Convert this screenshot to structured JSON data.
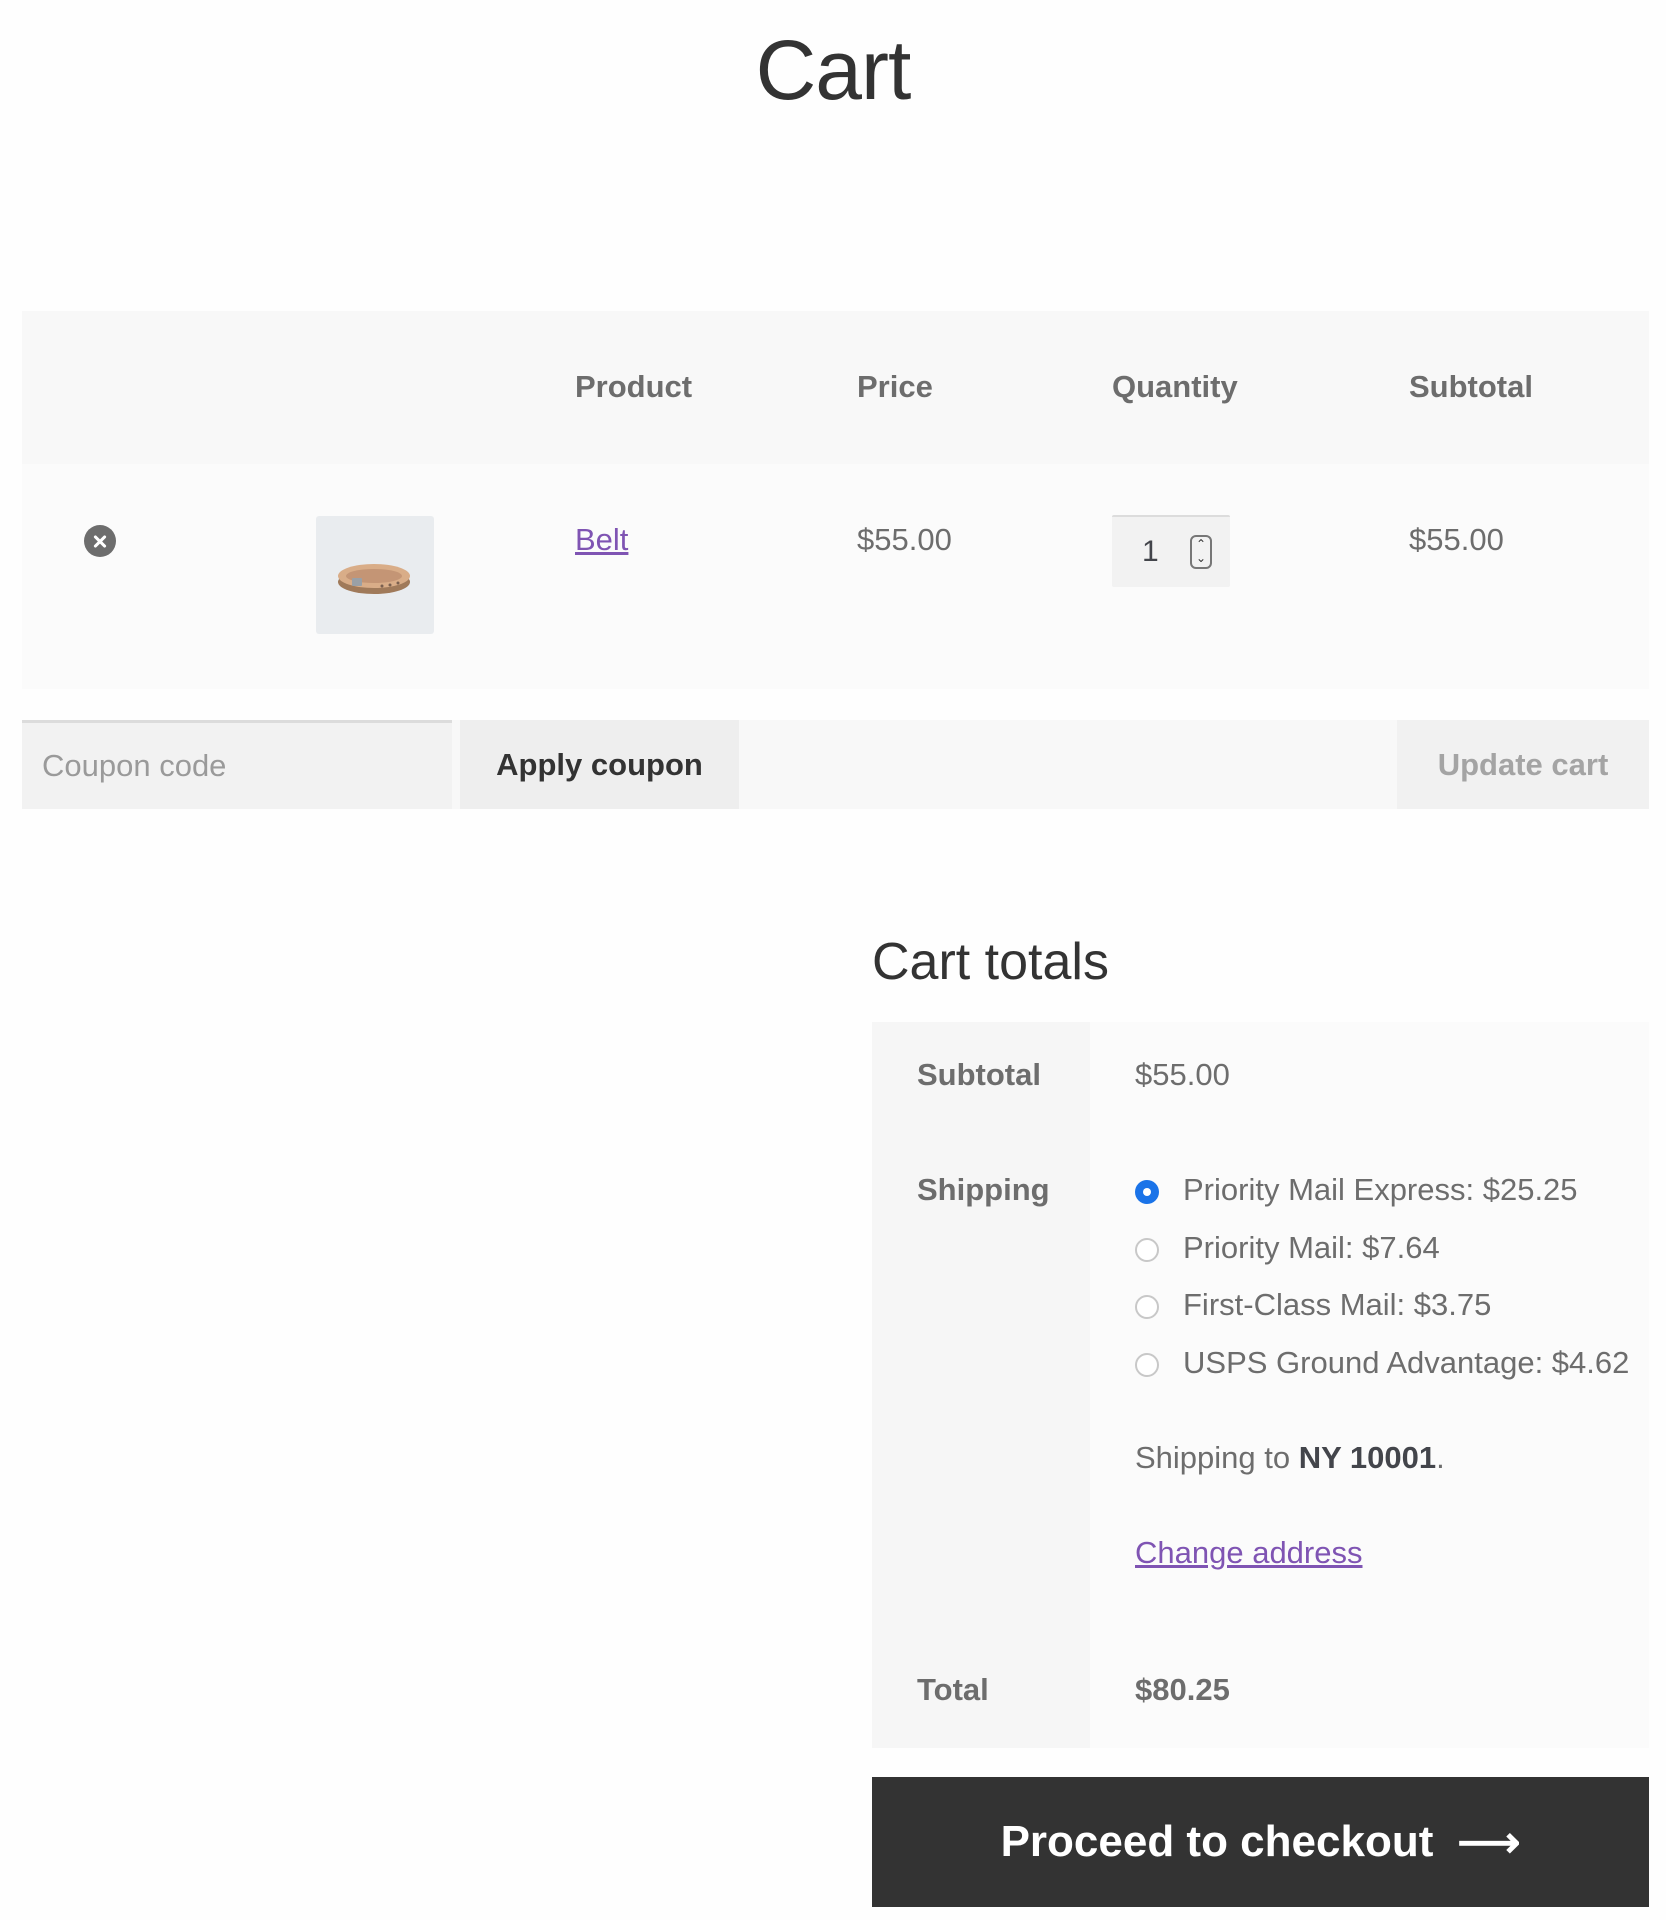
{
  "page": {
    "title": "Cart"
  },
  "cart_table": {
    "headers": {
      "product": "Product",
      "price": "Price",
      "quantity": "Quantity",
      "subtotal": "Subtotal"
    },
    "items": [
      {
        "name": "Belt",
        "price": "$55.00",
        "quantity": "1",
        "subtotal": "$55.00",
        "thumbnail_icon": "belt-image"
      }
    ]
  },
  "actions": {
    "coupon_placeholder": "Coupon code",
    "apply_coupon": "Apply coupon",
    "update_cart": "Update cart"
  },
  "totals": {
    "title": "Cart totals",
    "subtotal_label": "Subtotal",
    "subtotal_value": "$55.00",
    "shipping_label": "Shipping",
    "shipping_options": [
      {
        "label": "Priority Mail Express: $25.25",
        "selected": true
      },
      {
        "label": "Priority Mail: $7.64",
        "selected": false
      },
      {
        "label": "First-Class Mail: $3.75",
        "selected": false
      },
      {
        "label": "USPS Ground Advantage: $4.62",
        "selected": false
      }
    ],
    "shipping_to_prefix": "Shipping to",
    "shipping_to_location": "NY 10001",
    "shipping_to_suffix": ".",
    "change_address": "Change address",
    "total_label": "Total",
    "total_value": "$80.25"
  },
  "checkout": {
    "label": "Proceed to checkout",
    "arrow": "⟶"
  },
  "colors": {
    "accent_link": "#7f54b3",
    "checkout_bg": "#333333",
    "radio_selected": "#1a73e8"
  }
}
